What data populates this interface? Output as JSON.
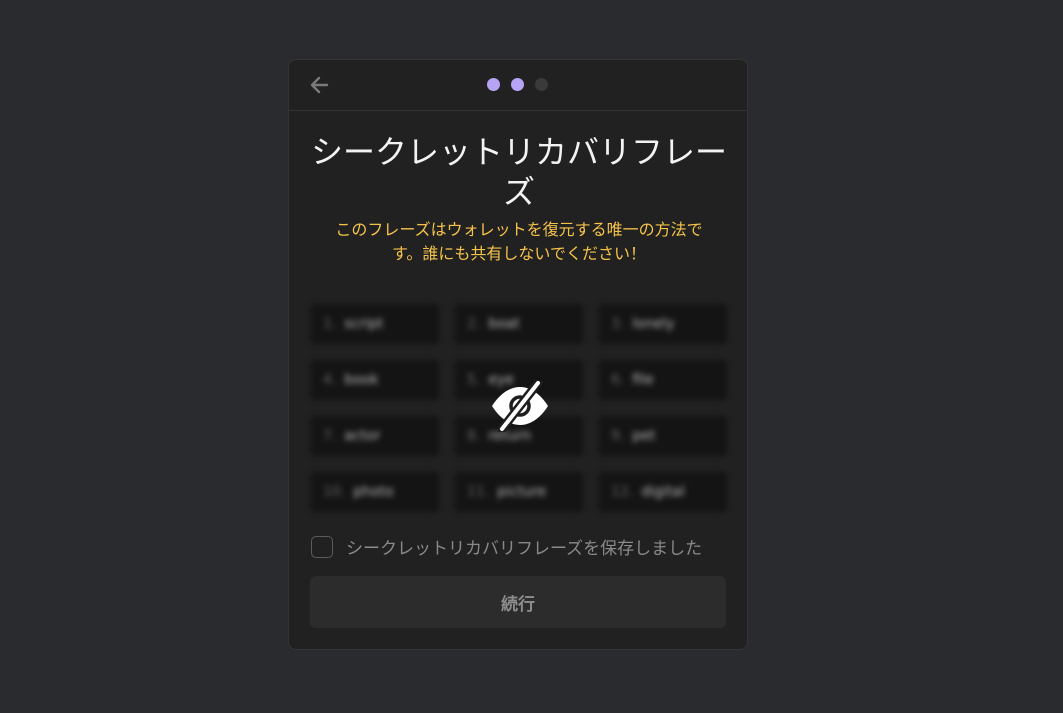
{
  "header": {
    "back_icon": "arrow-left-icon",
    "steps_total": 3,
    "steps_completed": 2,
    "active_color": "#b7a4f4",
    "inactive_color": "#3a3a3a"
  },
  "title": "シークレットリカバリフレーズ",
  "warning": "このフレーズはウォレットを復元する唯一の方法です。誰にも共有しないでください！",
  "warning_color": "#f6c34a",
  "phrase": {
    "blurred": true,
    "reveal_icon": "eye-slash-icon",
    "words": [
      {
        "num": "1.",
        "word": "script"
      },
      {
        "num": "2.",
        "word": "boat"
      },
      {
        "num": "3.",
        "word": "lonely"
      },
      {
        "num": "4.",
        "word": "book"
      },
      {
        "num": "5.",
        "word": "eye"
      },
      {
        "num": "6.",
        "word": "file"
      },
      {
        "num": "7.",
        "word": "actor"
      },
      {
        "num": "8.",
        "word": "return"
      },
      {
        "num": "9.",
        "word": "pet"
      },
      {
        "num": "10.",
        "word": "photo"
      },
      {
        "num": "11.",
        "word": "picture"
      },
      {
        "num": "12.",
        "word": "digital"
      }
    ]
  },
  "confirm": {
    "label": "シークレットリカバリフレーズを保存しました",
    "checked": false
  },
  "continue_label": "続行"
}
